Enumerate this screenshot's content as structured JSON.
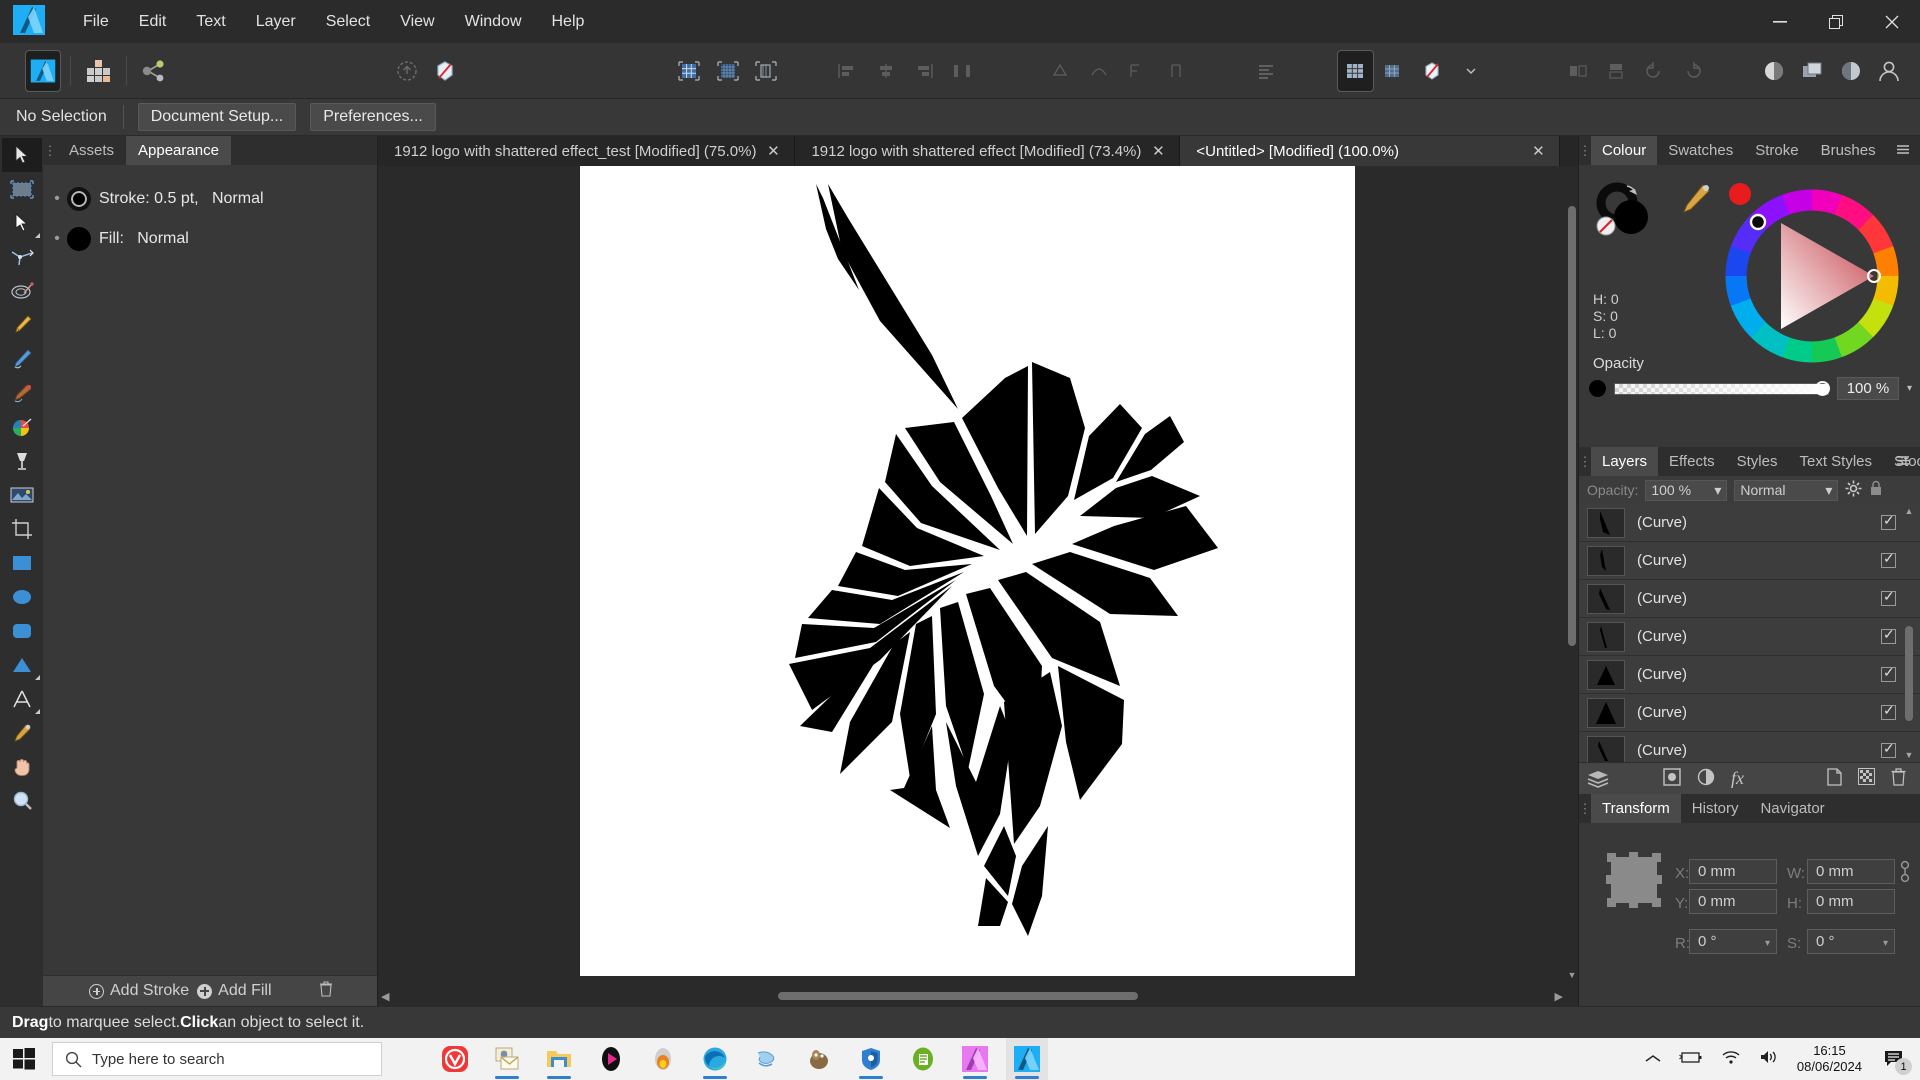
{
  "app": {
    "name": "Affinity Designer",
    "accent": "#1daef5"
  },
  "menubar": {
    "items": [
      "File",
      "Edit",
      "Text",
      "Layer",
      "Select",
      "View",
      "Window",
      "Help"
    ]
  },
  "window_controls": {
    "minimize": "–",
    "restore": "❐",
    "close": "✕"
  },
  "context_bar": {
    "selection_label": "No Selection",
    "document_setup": "Document Setup...",
    "preferences": "Preferences..."
  },
  "document_tabs": [
    {
      "title": "1912 logo with shattered effect_test [Modified] (75.0%)",
      "close": "✕",
      "active": false
    },
    {
      "title": "1912 logo with shattered effect [Modified] (73.4%)",
      "close": "✕",
      "active": false
    },
    {
      "title": "<Untitled> [Modified] (100.0%)",
      "close": "✕",
      "active": true
    }
  ],
  "tools": [
    {
      "name": "move-tool",
      "selected": true
    },
    {
      "name": "artboard-tool",
      "selected": false
    },
    {
      "name": "node-tool",
      "selected": false
    },
    {
      "name": "corner-tool",
      "selected": false
    },
    {
      "name": "vector-crop-tool",
      "selected": false
    },
    {
      "name": "pen-tool",
      "selected": false
    },
    {
      "name": "pencil-tool",
      "selected": false
    },
    {
      "name": "vector-brush-tool",
      "selected": false
    },
    {
      "name": "fill-tool",
      "selected": false
    },
    {
      "name": "transparency-tool",
      "selected": false
    },
    {
      "name": "place-image-tool",
      "selected": false
    },
    {
      "name": "crop-tool",
      "selected": false
    },
    {
      "name": "rectangle-tool",
      "selected": false
    },
    {
      "name": "ellipse-tool",
      "selected": false
    },
    {
      "name": "rounded-rectangle-tool",
      "selected": false
    },
    {
      "name": "triangle-tool",
      "selected": false
    },
    {
      "name": "artistic-text-tool",
      "selected": false
    },
    {
      "name": "colour-picker-tool",
      "selected": false
    },
    {
      "name": "view-pan-tool",
      "selected": false
    },
    {
      "name": "zoom-tool",
      "selected": false
    }
  ],
  "left_panel": {
    "tabs": [
      {
        "label": "Assets",
        "active": false
      },
      {
        "label": "Appearance",
        "active": true
      }
    ],
    "appearance": {
      "stroke_label": "Stroke:",
      "stroke_value": "0.5 pt,",
      "stroke_blend": "Normal",
      "fill_label": "Fill:",
      "fill_blend": "Normal"
    },
    "footer": {
      "add_stroke": "Add Stroke",
      "add_fill": "Add Fill"
    }
  },
  "colour_panel": {
    "tabs": [
      {
        "label": "Colour",
        "active": true
      },
      {
        "label": "Swatches",
        "active": false
      },
      {
        "label": "Stroke",
        "active": false
      },
      {
        "label": "Brushes",
        "active": false
      }
    ],
    "hsl": {
      "h": "H: 0",
      "s": "S: 0",
      "l": "L: 0"
    },
    "opacity_label": "Opacity",
    "opacity_value": "100 %",
    "fill_colour": "#000000",
    "stroke_colour": "#000000",
    "recent_colour": "#e81c1c"
  },
  "layers_panel": {
    "tabs": [
      {
        "label": "Layers",
        "active": true
      },
      {
        "label": "Effects",
        "active": false
      },
      {
        "label": "Styles",
        "active": false
      },
      {
        "label": "Text Styles",
        "active": false
      },
      {
        "label": "Stock",
        "active": false
      }
    ],
    "opacity_label": "Opacity:",
    "opacity_value": "100 %",
    "blend_mode": "Normal",
    "rows": [
      {
        "name": "(Curve)",
        "checked": true
      },
      {
        "name": "(Curve)",
        "checked": true
      },
      {
        "name": "(Curve)",
        "checked": true
      },
      {
        "name": "(Curve)",
        "checked": true
      },
      {
        "name": "(Curve)",
        "checked": true
      },
      {
        "name": "(Curve)",
        "checked": true
      },
      {
        "name": "(Curve)",
        "checked": true
      },
      {
        "name": "(Curve)",
        "checked": true
      }
    ]
  },
  "transform_panel": {
    "tabs": [
      {
        "label": "Transform",
        "active": true
      },
      {
        "label": "History",
        "active": false
      },
      {
        "label": "Navigator",
        "active": false
      }
    ],
    "fields": {
      "x_label": "X:",
      "x_value": "0 mm",
      "y_label": "Y:",
      "y_value": "0 mm",
      "w_label": "W:",
      "w_value": "0 mm",
      "h_label": "H:",
      "h_value": "0 mm",
      "r_label": "R:",
      "r_value": "0 °",
      "s_label": "S:",
      "s_value": "0 °"
    }
  },
  "status_bar": {
    "hint_bold_1": "Drag",
    "hint_text_1": " to marquee select. ",
    "hint_bold_2": "Click",
    "hint_text_2": " an object to select it."
  },
  "taskbar": {
    "search_placeholder": "Type here to search",
    "apps": [
      {
        "name": "vivaldi",
        "running": false
      },
      {
        "name": "mail",
        "running": true
      },
      {
        "name": "file-explorer",
        "running": true
      },
      {
        "name": "media-player",
        "running": false
      },
      {
        "name": "firefox-nightly",
        "running": false
      },
      {
        "name": "microsoft-edge",
        "running": true
      },
      {
        "name": "messenger",
        "running": false
      },
      {
        "name": "gimp",
        "running": false
      },
      {
        "name": "bitwarden",
        "running": true
      },
      {
        "name": "evernote",
        "running": false
      },
      {
        "name": "affinity-photo",
        "running": true
      },
      {
        "name": "affinity-designer",
        "running": true
      }
    ],
    "clock_time": "16:15",
    "clock_date": "08/06/2024",
    "notification_count": "1"
  }
}
